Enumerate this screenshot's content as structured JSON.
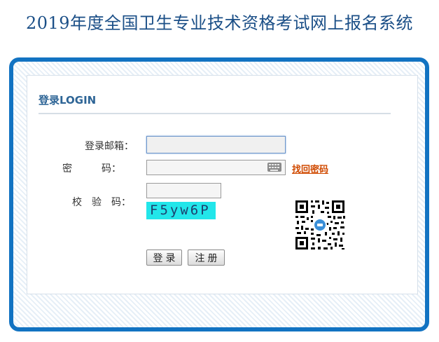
{
  "page": {
    "title": "2019年度全国卫生专业技术资格考试网上报名系统"
  },
  "login": {
    "heading": "登录LOGIN",
    "email_label": "登录邮箱：",
    "email_value": "",
    "password_label": "密　　　码：",
    "password_value": "",
    "captcha_label": "校　验　码：",
    "captcha_value": "",
    "captcha_text": "F5yw6P",
    "forgot_password": "找回密码",
    "login_button": "登录",
    "register_button": "注册"
  },
  "icons": {
    "password_keyboard": "keyboard-icon",
    "qr": "qr-code"
  },
  "colors": {
    "title": "#1b4f87",
    "frame": "#1273c2",
    "heading": "#2e6596",
    "link": "#d04a00",
    "captcha_bg": "#22e6ea"
  }
}
